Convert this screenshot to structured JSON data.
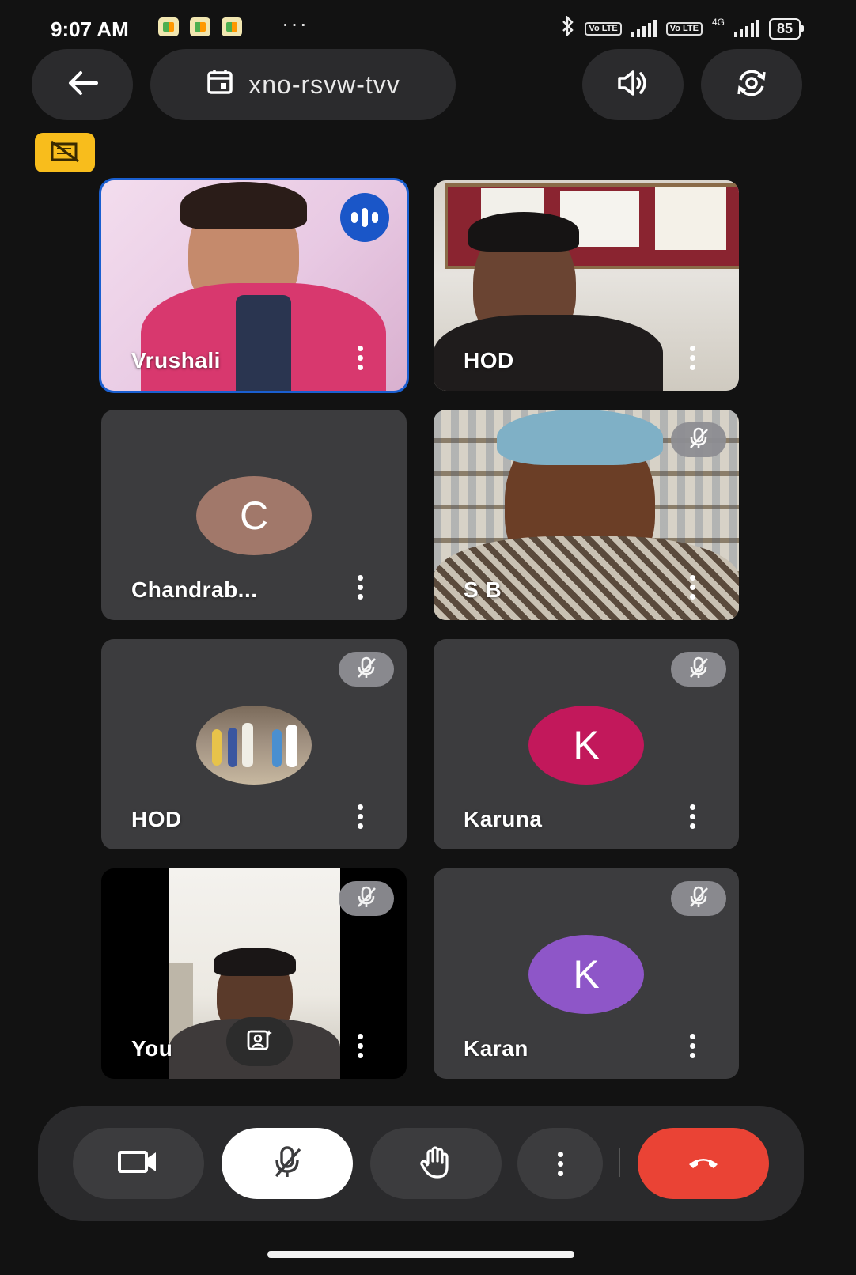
{
  "status_bar": {
    "time": "9:07 AM",
    "dots": "···",
    "network": "4G",
    "volte_1": "Vo LTE",
    "volte_2": "Vo LTE",
    "battery": "85"
  },
  "header": {
    "back_icon": "arrow-left-icon",
    "meeting_code": "xno-rsvw-tvv",
    "calendar_icon": "calendar-icon",
    "speaker_icon": "speaker-icon",
    "switch_camera_icon": "switch-camera-icon",
    "camera_off_badge_icon": "camera-off-icon"
  },
  "participants": [
    {
      "name": "Vrushali",
      "type": "video",
      "speaking": true,
      "muted": false
    },
    {
      "name": "HOD",
      "type": "video",
      "speaking": false,
      "muted": false
    },
    {
      "name": "Chandrab...",
      "type": "avatar",
      "initial": "C",
      "avatar_color": "#a1786a",
      "muted": false
    },
    {
      "name": "S B",
      "type": "video",
      "muted": true
    },
    {
      "name": "HOD",
      "type": "photo-avatar",
      "muted": true
    },
    {
      "name": "Karuna",
      "type": "avatar",
      "initial": "K",
      "avatar_color": "#c2185b",
      "muted": true
    },
    {
      "name": "You",
      "type": "self-video",
      "muted": true
    },
    {
      "name": "Karan",
      "type": "avatar",
      "initial": "K",
      "avatar_color": "#8e56c8",
      "muted": true
    }
  ],
  "controls": {
    "camera_icon": "video-camera-icon",
    "mic_icon": "mic-off-icon",
    "hand_icon": "raise-hand-icon",
    "more_icon": "more-vertical-icon",
    "leave_icon": "hang-up-icon",
    "leave_color": "#ea4335"
  },
  "colors": {
    "background": "#121212",
    "tile": "#3c3c3e",
    "active_border": "#1a5fd0",
    "badge_yellow": "#f8bd1c"
  }
}
